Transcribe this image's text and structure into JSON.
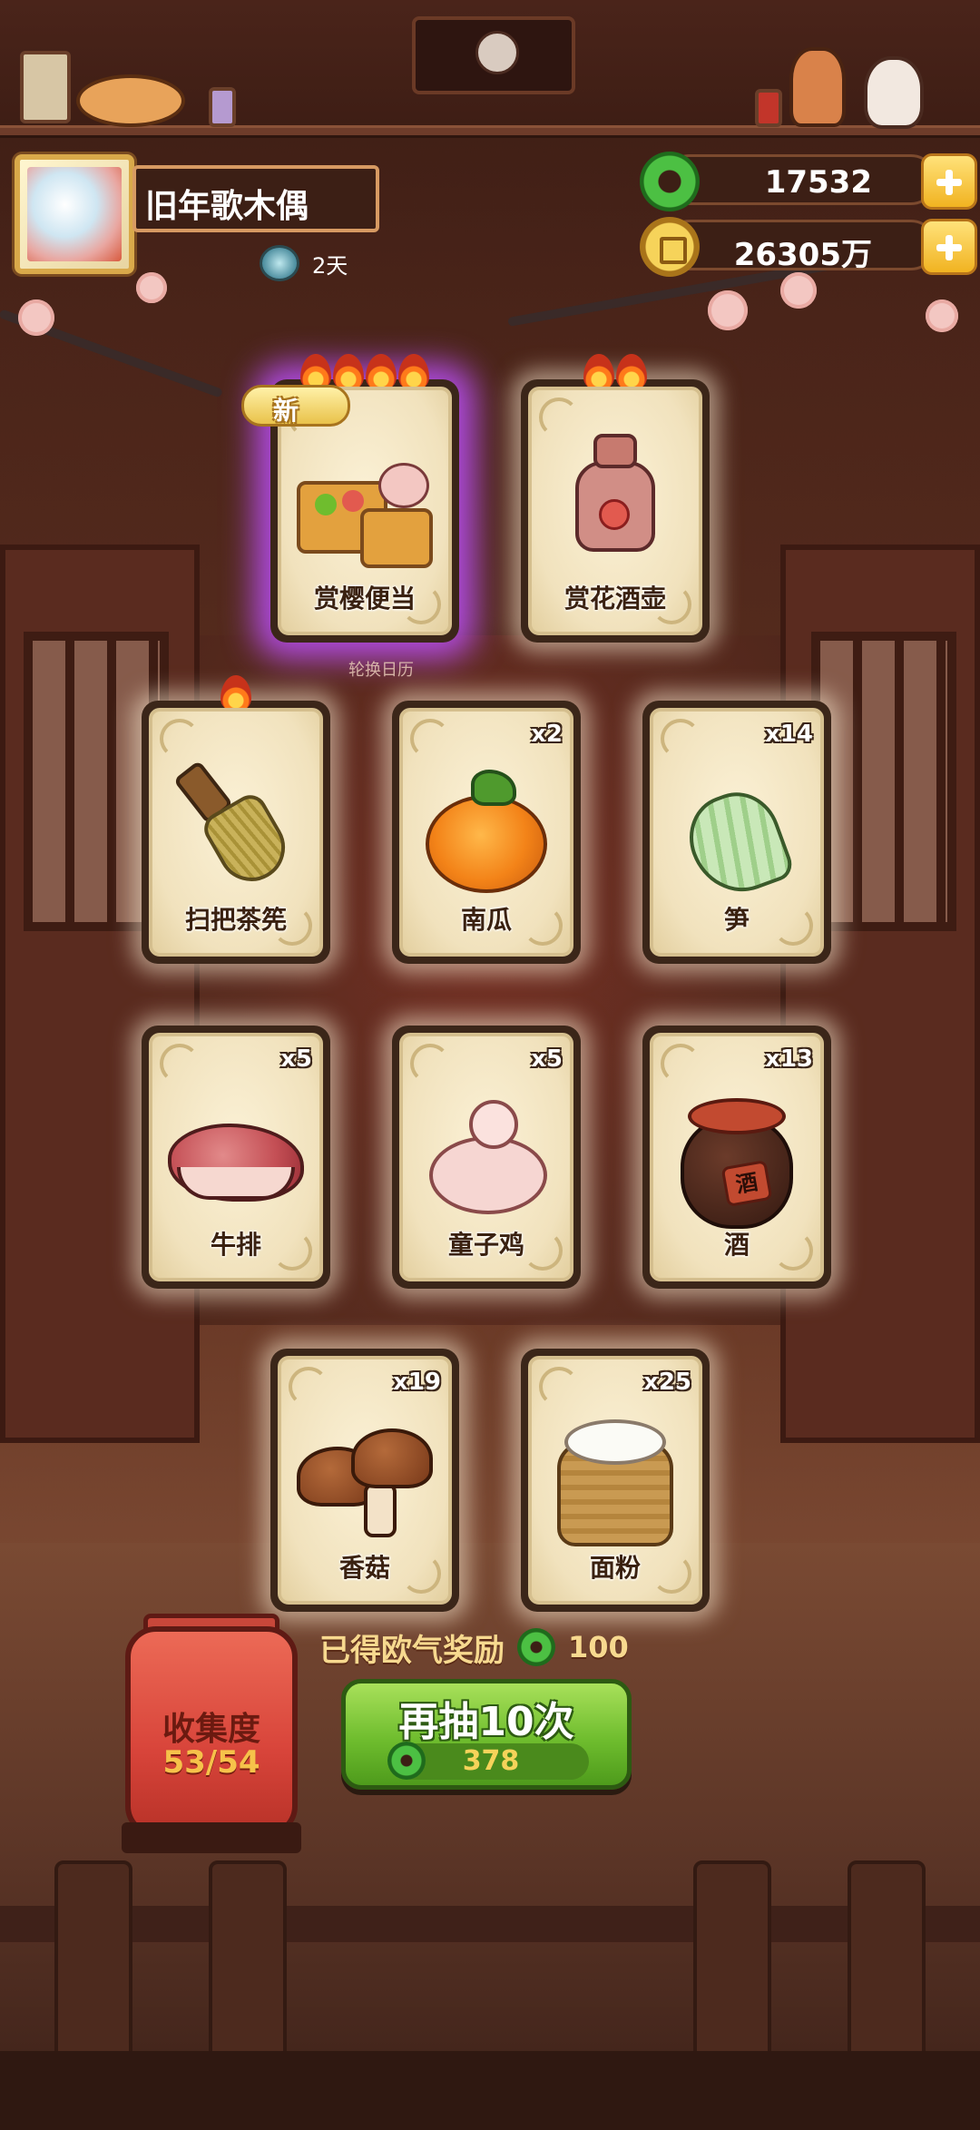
{
  "player": {
    "name": "旧年歌木偶",
    "days": "2天"
  },
  "currency": {
    "jade": "17532",
    "coins": "26305万"
  },
  "cards": [
    {
      "name": "赏樱便当",
      "count": "",
      "flames": 4,
      "is_new": true,
      "new_label": "新",
      "icon": "bento-icon"
    },
    {
      "name": "赏花酒壶",
      "count": "",
      "flames": 2,
      "is_new": false,
      "icon": "sake-bottle-icon"
    },
    {
      "name": "扫把茶筅",
      "count": "",
      "flames": 1,
      "is_new": false,
      "icon": "tea-whisk-icon"
    },
    {
      "name": "南瓜",
      "count": "x2",
      "flames": 0,
      "icon": "pumpkin-icon"
    },
    {
      "name": "笋",
      "count": "x14",
      "flames": 0,
      "icon": "bamboo-shoot-icon"
    },
    {
      "name": "牛排",
      "count": "x5",
      "flames": 0,
      "icon": "steak-icon"
    },
    {
      "name": "童子鸡",
      "count": "x5",
      "flames": 0,
      "icon": "chicken-icon"
    },
    {
      "name": "酒",
      "count": "x13",
      "flames": 0,
      "icon": "wine-jar-icon",
      "jar_label": "酒"
    },
    {
      "name": "香菇",
      "count": "x19",
      "flames": 0,
      "icon": "mushroom-icon"
    },
    {
      "name": "面粉",
      "count": "x25",
      "flames": 0,
      "icon": "flour-sack-icon"
    }
  ],
  "rotate_label": "轮换日历",
  "reward": {
    "label": "已得欧气奖励",
    "value": "100"
  },
  "collection": {
    "title": "收集度",
    "value": "53/54"
  },
  "draw_button": {
    "label": "再抽10次",
    "cost": "378"
  },
  "colors": {
    "accent_green": "#6fbd2e",
    "gold": "#f6d35a",
    "new_glow": "#be50ff"
  }
}
